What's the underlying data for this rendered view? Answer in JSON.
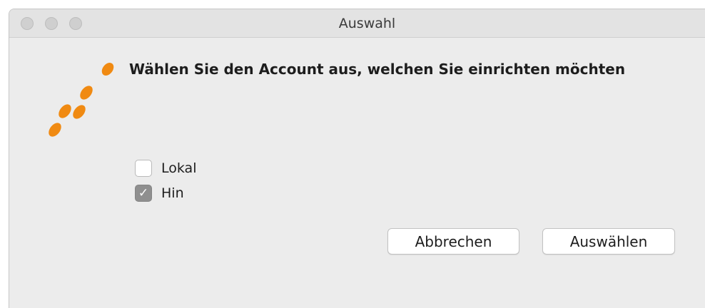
{
  "window": {
    "title": "Auswahl",
    "controls": [
      "close",
      "minimize",
      "zoom"
    ]
  },
  "dialog": {
    "message": "Wählen Sie den Account aus, welchen Sie einrichten möchten",
    "logo_icon": "orange-dots-logo",
    "accent_color": "#f08a12"
  },
  "options": [
    {
      "label": "Lokal",
      "checked": false
    },
    {
      "label": "Hin",
      "checked": true
    }
  ],
  "buttons": {
    "cancel_label": "Abbrechen",
    "select_label": "Auswählen"
  }
}
